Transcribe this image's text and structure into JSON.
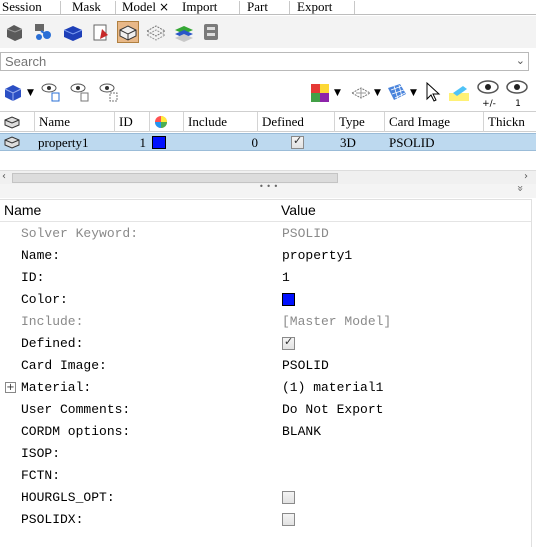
{
  "menu": {
    "tabs": [
      {
        "label": "Session"
      },
      {
        "label": "Mask"
      },
      {
        "label": "Model",
        "active": true,
        "close": "×"
      },
      {
        "label": "Import"
      },
      {
        "label": "Part"
      },
      {
        "label": "Export"
      }
    ]
  },
  "toolbar": {
    "icons": [
      "component-icon",
      "assembly-icon",
      "property-icon",
      "material-icon",
      "part-icon",
      "set-icon",
      "layers-icon",
      "system-icon"
    ],
    "selected": "part-icon"
  },
  "search": {
    "placeholder": "Search",
    "value": ""
  },
  "toolbar2": {
    "right_label": "+/-",
    "right_label2": "1"
  },
  "grid": {
    "columns": [
      "",
      "Name",
      "ID",
      "",
      "Include",
      "Defined",
      "Type",
      "Card Image",
      "Thickn"
    ],
    "row": {
      "name": "property1",
      "id": "1",
      "color": "#0010ff",
      "include": "0",
      "defined": true,
      "type": "3D",
      "card_image": "PSOLID"
    }
  },
  "splitter": {
    "grip": "• • •",
    "chevron": "»"
  },
  "props": {
    "header": {
      "name": "Name",
      "value": "Value"
    },
    "rows": [
      {
        "name": "Solver Keyword:",
        "value": "PSOLID",
        "muted": true
      },
      {
        "name": "Name:",
        "value": "property1"
      },
      {
        "name": "ID:",
        "value": "1"
      },
      {
        "name": "Color:",
        "value": "",
        "color": "#0010ff"
      },
      {
        "name": "Include:",
        "value": "[Master Model]",
        "muted": true
      },
      {
        "name": "Defined:",
        "value": "",
        "checkbox": true,
        "checked": true
      },
      {
        "name": "Card Image:",
        "value": "PSOLID"
      },
      {
        "name": "Material:",
        "value": "(1) material1",
        "expandable": true
      },
      {
        "name": "User Comments:",
        "value": "Do Not Export"
      },
      {
        "name": "CORDM options:",
        "value": "BLANK"
      },
      {
        "name": "ISOP:",
        "value": ""
      },
      {
        "name": "FCTN:",
        "value": ""
      },
      {
        "name": "HOURGLS_OPT:",
        "value": "",
        "checkbox": true,
        "checked": false
      },
      {
        "name": "PSOLIDX:",
        "value": "",
        "checkbox": true,
        "checked": false
      }
    ]
  },
  "colors": {
    "selection": "#bdd9ef",
    "accent": "#0010ff"
  }
}
